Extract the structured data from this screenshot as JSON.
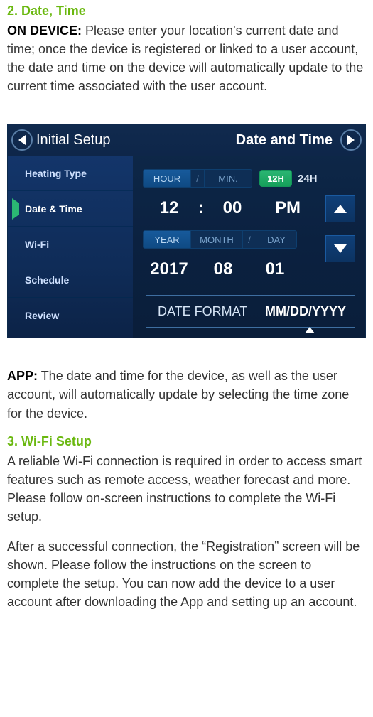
{
  "section2": {
    "heading": "2.  Date, Time",
    "on_device_label": "ON DEVICE:",
    "on_device_text": " Please enter your location's current date and time; once the device is registered or linked to a user account, the date and time on the device will automatically update to the current time associated with the user account."
  },
  "device": {
    "titlebar": {
      "back": "Initial Setup",
      "right": "Date and Time"
    },
    "sidebar": {
      "items": [
        {
          "label": "Heating Type"
        },
        {
          "label": "Date & Time"
        },
        {
          "label": "Wi-Fi"
        },
        {
          "label": "Schedule"
        },
        {
          "label": "Review"
        }
      ]
    },
    "time_panel": {
      "hour_label": "HOUR",
      "min_label": "MIN.",
      "btn12": "12H",
      "lbl24": "24H",
      "hour": "12",
      "minute": "00",
      "ampm": "PM",
      "year_label": "YEAR",
      "month_label": "MONTH",
      "day_label": "DAY",
      "year": "2017",
      "month": "08",
      "day": "01",
      "date_format_label": "DATE FORMAT",
      "date_format_value": "MM/DD/YYYY"
    }
  },
  "app_section": {
    "label": "APP:",
    "text": " The date and time for the device, as well as the user account, will automatically update by selecting the time zone for the device."
  },
  "section3": {
    "heading": "3.  Wi-Fi Setup",
    "p1": "A reliable Wi-Fi connection is required in order to access smart features such as remote access, weather forecast and more. Please follow on-screen instructions to complete the Wi-Fi setup.",
    "p2": "After a successful connection, the “Registration” screen will be shown. Please follow the instructions on the screen to complete the setup. You can now add the device to a user account after downloading the App and setting up an account."
  }
}
